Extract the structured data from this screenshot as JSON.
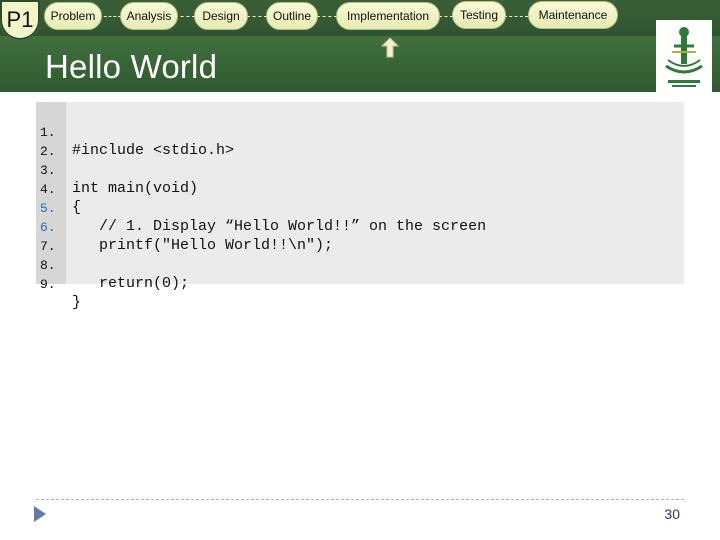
{
  "header": {
    "badge": "P1",
    "steps": [
      "Problem",
      "Analysis",
      "Design",
      "Outline",
      "Implementation",
      "Testing",
      "Maintenance"
    ],
    "title": "Hello World"
  },
  "code": {
    "line_numbers": [
      "1.",
      "2.",
      "3.",
      "4.",
      "5.",
      "6.",
      "7.",
      "8.",
      "9."
    ],
    "lines": [
      "#include <stdio.h>",
      "",
      "int main(void)",
      "{",
      "   // 1. Display “Hello World!!” on the screen",
      "   printf(\"Hello World!!\\n\");",
      "",
      "   return(0);",
      "}"
    ]
  },
  "footer": {
    "page": "30"
  },
  "colors": {
    "header_green": "#3d6a3a",
    "pill": "#f8fad6",
    "code_bg": "#ebebeb",
    "line_no_blue": "#1b6fb5"
  }
}
